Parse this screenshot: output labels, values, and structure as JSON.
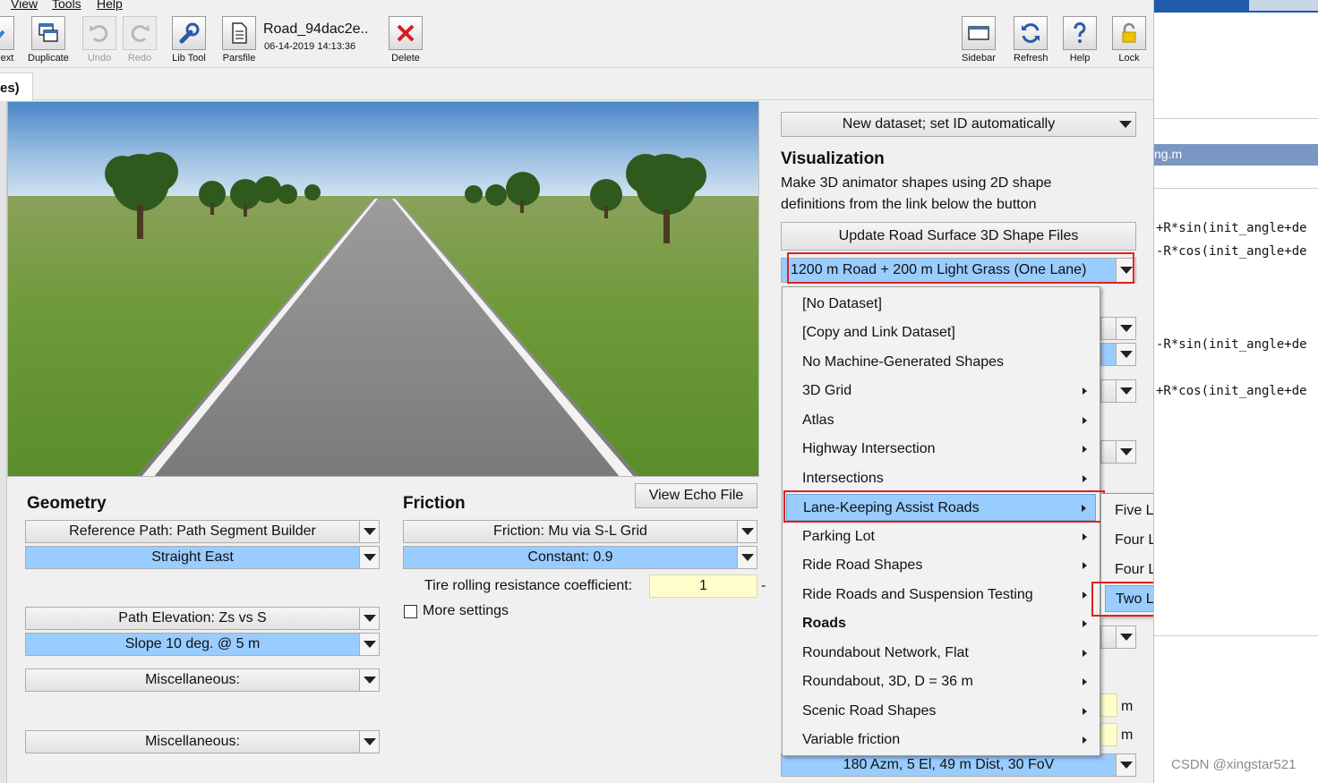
{
  "menubar": {
    "view": "View",
    "tools": "Tools",
    "help": "Help"
  },
  "toolbar": {
    "next": "ext",
    "duplicate": "Duplicate",
    "undo": "Undo",
    "redo": "Redo",
    "libtool": "Lib Tool",
    "parsfile": "Parsfile",
    "doc_name": "Road_94dac2e..",
    "doc_date": "06-14-2019 14:13:36",
    "delete": "Delete",
    "sidebar": "Sidebar",
    "refresh": "Refresh",
    "help": "Help",
    "lock": "Lock"
  },
  "tab": {
    "label": "es)"
  },
  "geometry": {
    "title": "Geometry",
    "reference_path": "Reference Path: Path Segment Builder",
    "reference_value": "Straight East",
    "elevation": "Path Elevation: Zs vs S",
    "elevation_value": "Slope 10 deg. @ 5 m",
    "misc1": "Miscellaneous:",
    "misc2": "Miscellaneous:"
  },
  "friction": {
    "title": "Friction",
    "view_echo": "View Echo File",
    "mode": "Friction: Mu via S-L Grid",
    "value": "Constant: 0.9",
    "tire_label": "Tire rolling resistance coefficient:",
    "tire_value": "1",
    "tire_unit": "-",
    "more_settings": "More settings"
  },
  "right": {
    "dataset": "New dataset; set ID automatically",
    "vis_title": "Visualization",
    "vis_desc1": "Make 3D animator shapes using 2D shape",
    "vis_desc2": "definitions from the link below the button",
    "update_btn": "Update Road Surface 3D Shape Files",
    "shape_select": "1200 m Road + 200 m Light Grass (One Lane)",
    "camera": "180 Azm, 5 El, 49 m Dist, 30 FoV",
    "unit_m1": "m",
    "unit_m2": "m"
  },
  "menu": {
    "items": [
      {
        "label": "[No Dataset]"
      },
      {
        "label": "[Copy and Link Dataset]"
      },
      {
        "label": "No Machine-Generated Shapes"
      },
      {
        "label": "3D Grid"
      },
      {
        "label": "Atlas"
      },
      {
        "label": "Highway Intersection"
      },
      {
        "label": "Intersections"
      },
      {
        "label": "Lane-Keeping Assist Roads"
      },
      {
        "label": "Parking Lot"
      },
      {
        "label": "Ride Road Shapes"
      },
      {
        "label": "Ride Roads and Suspension Testing"
      },
      {
        "label": "Roads"
      },
      {
        "label": "Roundabout Network, Flat"
      },
      {
        "label": "Roundabout, 3D, D = 36 m"
      },
      {
        "label": "Scenic Road Shapes"
      },
      {
        "label": "Variable friction"
      }
    ]
  },
  "submenu": {
    "items": [
      {
        "label": "Five Lanes"
      },
      {
        "label": "Four Lanes"
      },
      {
        "label": "Four Lanes (Adjacent)"
      },
      {
        "label": "Two Lanes"
      }
    ]
  },
  "editor": {
    "tab": "ng.m",
    "line1": "+R*sin(init_angle+de",
    "line2": "-R*cos(init_angle+de",
    "line3": "-R*sin(init_angle+de",
    "line4": "+R*cos(init_angle+de"
  },
  "watermark": "CSDN @xingstar521"
}
